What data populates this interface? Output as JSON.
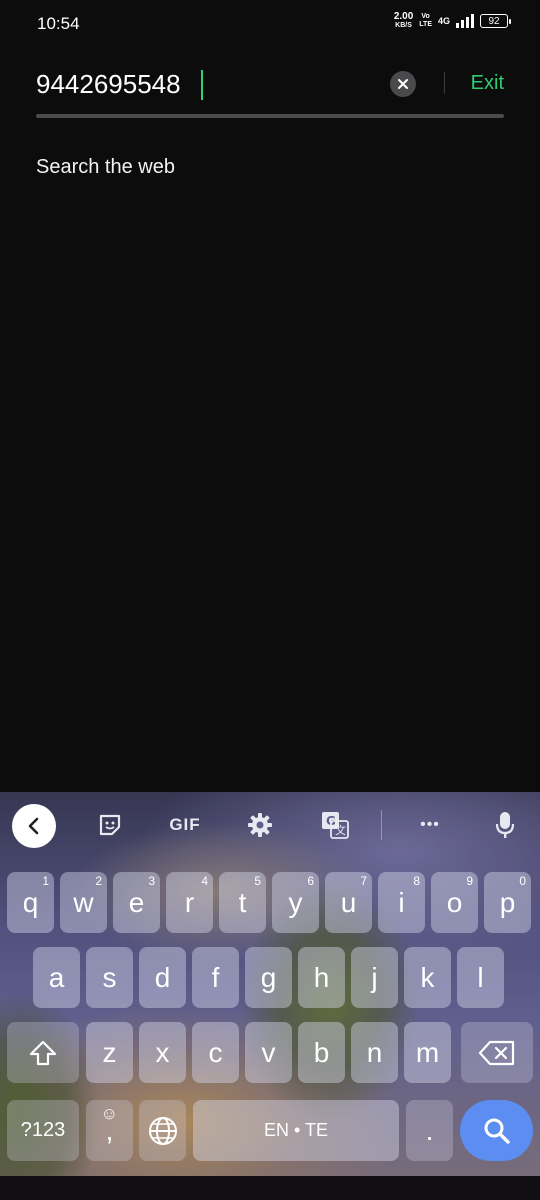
{
  "status_bar": {
    "time": "10:54",
    "net_speed": "2.00",
    "net_speed_unit": "KB/S",
    "volte_top": "Vo",
    "volte_bottom": "LTE",
    "network_type": "4G",
    "battery": "92"
  },
  "search": {
    "query": "9442695548",
    "exit_label": "Exit"
  },
  "suggestions": [
    {
      "label": "Search the web"
    }
  ],
  "keyboard": {
    "toolbar_icons": [
      "back-chevron-icon",
      "sticker-icon",
      "gif-icon",
      "settings-gear-icon",
      "translate-icon",
      "more-dots-icon",
      "microphone-icon"
    ],
    "gif_label": "GIF",
    "more_label": "•••",
    "row1": [
      {
        "key": "q",
        "hint": "1"
      },
      {
        "key": "w",
        "hint": "2"
      },
      {
        "key": "e",
        "hint": "3"
      },
      {
        "key": "r",
        "hint": "4"
      },
      {
        "key": "t",
        "hint": "5"
      },
      {
        "key": "y",
        "hint": "6"
      },
      {
        "key": "u",
        "hint": "7"
      },
      {
        "key": "i",
        "hint": "8"
      },
      {
        "key": "o",
        "hint": "9"
      },
      {
        "key": "p",
        "hint": "0"
      }
    ],
    "row2": [
      "a",
      "s",
      "d",
      "f",
      "g",
      "h",
      "j",
      "k",
      "l"
    ],
    "row3": [
      "z",
      "x",
      "c",
      "v",
      "b",
      "n",
      "m"
    ],
    "symbols_label": "?123",
    "comma_label": ",",
    "emoji_label": "☺",
    "space_label": "EN • TE",
    "period_label": ".",
    "accent_color": "#5b8ef0"
  },
  "colors": {
    "background": "#0c0c0d",
    "exit_green": "#2ecc71",
    "caret_green": "#2fd27a"
  }
}
